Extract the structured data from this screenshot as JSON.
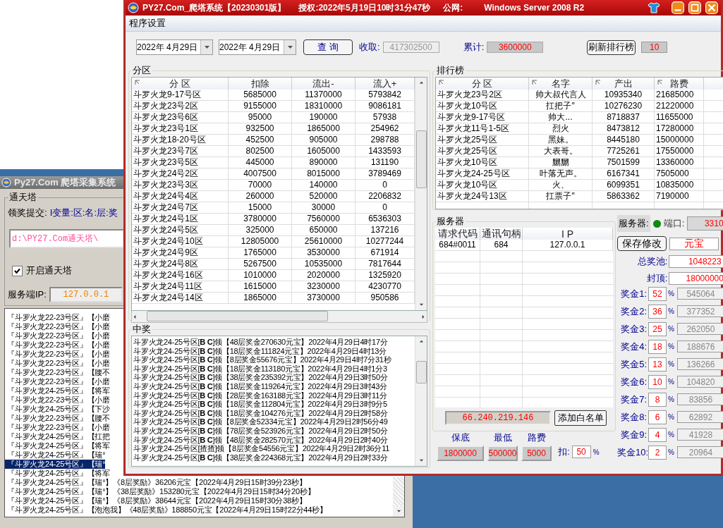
{
  "background_window": {
    "title": "Py27.Com 爬塔采集系统",
    "group": "通天塔",
    "submit_label": "领奖提交:",
    "submit_format": "I变量:区:名:层:奖",
    "path": "d:\\PY27.Com通天塔\\",
    "enable": {
      "label": "开启通天塔",
      "checked": true
    },
    "server_ip_label": "服务端IP:",
    "server_ip": "127.0.0.1",
    "log": [
      {
        "text": "『斗罗火龙22-23号区』【小磨",
        "selected": false
      },
      {
        "text": "『斗罗火龙22-23号区』【小磨",
        "selected": false
      },
      {
        "text": "『斗罗火龙22-23号区』【小磨",
        "selected": false
      },
      {
        "text": "『斗罗火龙22-23号区』【小磨",
        "selected": false
      },
      {
        "text": "『斗罗火龙22-23号区』【小磨",
        "selected": false
      },
      {
        "text": "『斗罗火龙22-23号区』【小磨",
        "selected": false
      },
      {
        "text": "『斗罗火龙22-23号区』【腰不",
        "selected": false
      },
      {
        "text": "『斗罗火龙22-23号区』【小磨",
        "selected": false
      },
      {
        "text": "『斗罗火龙24-25号区』【将军",
        "selected": false
      },
      {
        "text": "『斗罗火龙22-23号区』【小磨",
        "selected": false
      },
      {
        "text": "『斗罗火龙24-25号区』【下沙",
        "selected": false
      },
      {
        "text": "『斗罗火龙22-23号区』【腰不",
        "selected": false
      },
      {
        "text": "『斗罗火龙22-23号区』【小磨",
        "selected": false
      },
      {
        "text": "『斗罗火龙24-25号区』【扛把",
        "selected": false
      },
      {
        "text": "『斗罗火龙24-25号区』【将军",
        "selected": false
      },
      {
        "text": "『斗罗火龙24-25号区』【瑞°",
        "selected": false
      },
      {
        "text": "『斗罗火龙24-25号区』【瑞°",
        "selected": true
      },
      {
        "text": "『斗罗火龙24-25号区』【将军",
        "selected": false
      },
      {
        "text": "『斗罗火龙24-25号区』【瑞°】《8层奖励》36206元宝【2022年4月29日15时39分23秒】",
        "selected": false
      },
      {
        "text": "『斗罗火龙24-25号区』【瑞°】《38层奖励》153280元宝【2022年4月29日15时34分20秒】",
        "selected": false
      },
      {
        "text": "『斗罗火龙24-25号区』【瑞°】《8层奖励》38644元宝【2022年4月29日15时30分38秒】",
        "selected": false
      },
      {
        "text": "『斗罗火龙24-25号区』【泡泡我】《48层奖励》188850元宝【2022年4月29日15时22分44秒】",
        "selected": false
      }
    ]
  },
  "window": {
    "title": "PY27.Com_爬塔系统【20230301版】",
    "license": "授权:2022年5月19日10时31分47秒",
    "public_label": "公网:",
    "os": "Windows Server 2008 R2"
  },
  "menu": [
    "程序设置"
  ],
  "query": {
    "date_from": "2022年 4月29日",
    "date_to": "2022年 4月29日",
    "button": "查 询",
    "collected_label": "收取:",
    "collected": "417302500",
    "total_label": "累计:",
    "total": "3600000",
    "refresh_button": "刷新排行榜",
    "rank_count": "10"
  },
  "zones": {
    "title": "分区",
    "columns": [
      "分 区",
      "扣除",
      "流出-",
      "流入+"
    ],
    "rows": [
      [
        "斗罗火龙9-17号区",
        "5685000",
        "11370000",
        "5793842"
      ],
      [
        "斗罗火龙23号2区",
        "9155000",
        "18310000",
        "9086181"
      ],
      [
        "斗罗火龙23号6区",
        "95000",
        "190000",
        "57938"
      ],
      [
        "斗罗火龙23号1区",
        "932500",
        "1865000",
        "254962"
      ],
      [
        "斗罗火龙18-20号区",
        "452500",
        "905000",
        "298788"
      ],
      [
        "斗罗火龙23号7区",
        "802500",
        "1605000",
        "1433593"
      ],
      [
        "斗罗火龙23号5区",
        "445000",
        "890000",
        "131190"
      ],
      [
        "斗罗火龙24号2区",
        "4007500",
        "8015000",
        "3789469"
      ],
      [
        "斗罗火龙23号3区",
        "70000",
        "140000",
        "0"
      ],
      [
        "斗罗火龙24号4区",
        "260000",
        "520000",
        "2206832"
      ],
      [
        "斗罗火龙24号7区",
        "15000",
        "30000",
        "0"
      ],
      [
        "斗罗火龙24号1区",
        "3780000",
        "7560000",
        "6536303"
      ],
      [
        "斗罗火龙24号5区",
        "325000",
        "650000",
        "137216"
      ],
      [
        "斗罗火龙24号10区",
        "12805000",
        "25610000",
        "10277244"
      ],
      [
        "斗罗火龙24号9区",
        "1765000",
        "3530000",
        "671914"
      ],
      [
        "斗罗火龙24号8区",
        "5267500",
        "10535000",
        "7817644"
      ],
      [
        "斗罗火龙24号16区",
        "1010000",
        "2020000",
        "1325920"
      ],
      [
        "斗罗火龙24号11区",
        "1615000",
        "3230000",
        "4230770"
      ],
      [
        "斗罗火龙24号14区",
        "1865000",
        "3730000",
        "950586"
      ]
    ]
  },
  "ranking": {
    "title": "排行榜",
    "columns": [
      "分 区",
      "名字",
      "产出",
      "路费"
    ],
    "rows": [
      [
        "斗罗火龙23号2区",
        "帅大叔代言人",
        "10935340",
        "21685000"
      ],
      [
        "斗罗火龙10号区",
        "扛把子″",
        "10276230",
        "21220000"
      ],
      [
        "斗罗火龙9-17号区",
        "帅大...",
        "8718837",
        "11655000"
      ],
      [
        "斗罗火龙11号1-5区",
        "烈火",
        "8473812",
        "17280000"
      ],
      [
        "斗罗火龙25号区",
        "黑妹。",
        "8445180",
        "15000000"
      ],
      [
        "斗罗火龙25号区",
        "大表哥。",
        "7725261",
        "17550000"
      ],
      [
        "斗罗火龙10号区",
        "嬲嬲",
        "7501599",
        "13360000"
      ],
      [
        "斗罗火龙24-25号区",
        "叶落无声。",
        "6167341",
        "7505000"
      ],
      [
        "斗罗火龙10号区",
        "火、",
        "6099351",
        "10835000"
      ],
      [
        "斗罗火龙24号13区",
        "扛票子″",
        "5863362",
        "7190000"
      ]
    ]
  },
  "server": {
    "title": "服务器",
    "columns": [
      "请求代码",
      "通讯句柄",
      "I P"
    ],
    "rows": [
      [
        "684#0011",
        "684",
        "127.0.0.1"
      ]
    ],
    "whitelist_ip": "66.240.219.146",
    "whitelist_button": "添加白名单"
  },
  "fees": {
    "items": [
      {
        "label": "保底",
        "value": "1800000"
      },
      {
        "label": "最低",
        "value": "500000"
      },
      {
        "label": "路费",
        "value": "5000"
      }
    ],
    "deduct_label": "扣:",
    "deduct": "50",
    "percent_sign": "%"
  },
  "status": {
    "server_label": "服务器:",
    "online": true,
    "port_label": "端口:",
    "port": "3310",
    "save_button": "保存修改",
    "currency": "元宝",
    "pool_label": "总奖池:",
    "pool": "1048223",
    "cap_label": "封顶:",
    "cap": "18000000"
  },
  "prizes": [
    {
      "label": "奖金1:",
      "percent": "52",
      "percent_sign": "%",
      "amount": "545064"
    },
    {
      "label": "奖金2:",
      "percent": "36",
      "percent_sign": "%",
      "amount": "377352"
    },
    {
      "label": "奖金3:",
      "percent": "25",
      "percent_sign": "%",
      "amount": "262050"
    },
    {
      "label": "奖金4:",
      "percent": "18",
      "percent_sign": "%",
      "amount": "188676"
    },
    {
      "label": "奖金5:",
      "percent": "13",
      "percent_sign": "%",
      "amount": "136266"
    },
    {
      "label": "奖金6:",
      "percent": "10",
      "percent_sign": "%",
      "amount": "104820"
    },
    {
      "label": "奖金7:",
      "percent": "8",
      "percent_sign": "%",
      "amount": "83856"
    },
    {
      "label": "奖金8:",
      "percent": "6",
      "percent_sign": "%",
      "amount": "62892"
    },
    {
      "label": "奖金9:",
      "percent": "4",
      "percent_sign": "%",
      "amount": "41928"
    },
    {
      "label": "奖金10:",
      "percent": "2",
      "percent_sign": "%",
      "amount": "20964"
    }
  ],
  "winners": {
    "title": "中奖",
    "lines": [
      "斗罗火龙24-25号区[**B C**]领【48层奖金270630元宝】2022年4月29日4时17分",
      "斗罗火龙24-25号区[**B C**]领【18层奖金111824元宝】2022年4月29日4时13分",
      "斗罗火龙24-25号区[**B C**]领【8层奖金55676元宝】2022年4月29日4时7分31秒",
      "斗罗火龙24-25号区[**B C**]领【18层奖金113180元宝】2022年4月29日4时1分3",
      "斗罗火龙24-25号区[**B C**]领【38层奖金235392元宝】2022年4月29日3时50分",
      "斗罗火龙24-25号区[**B C**]领【18层奖金119264元宝】2022年4月29日3时43分",
      "斗罗火龙24-25号区[**B C**]领【28层奖金163188元宝】2022年4月29日3时11分",
      "斗罗火龙24-25号区[**B C**]领【18层奖金112804元宝】2022年4月29日3时9分5",
      "斗罗火龙24-25号区[**B C**]领【18层奖金104276元宝】2022年4月29日2时58分",
      "斗罗火龙24-25号区[**B C**]领【8层奖金52334元宝】2022年4月29日2时56分49",
      "斗罗火龙24-25号区[**B C**]领【78层奖金523926元宝】2022年4月29日2时50分",
      "斗罗火龙24-25号区[**B C**]领【48层奖金282570元宝】2022年4月29日2时40分",
      "斗罗火龙24-25号区[揸揸]领【8层奖金54556元宝】2022年4月29日2时36分11",
      "斗罗火龙24-25号区[**B C**]领【38层奖金224368元宝】2022年4月29日2时33分"
    ]
  }
}
